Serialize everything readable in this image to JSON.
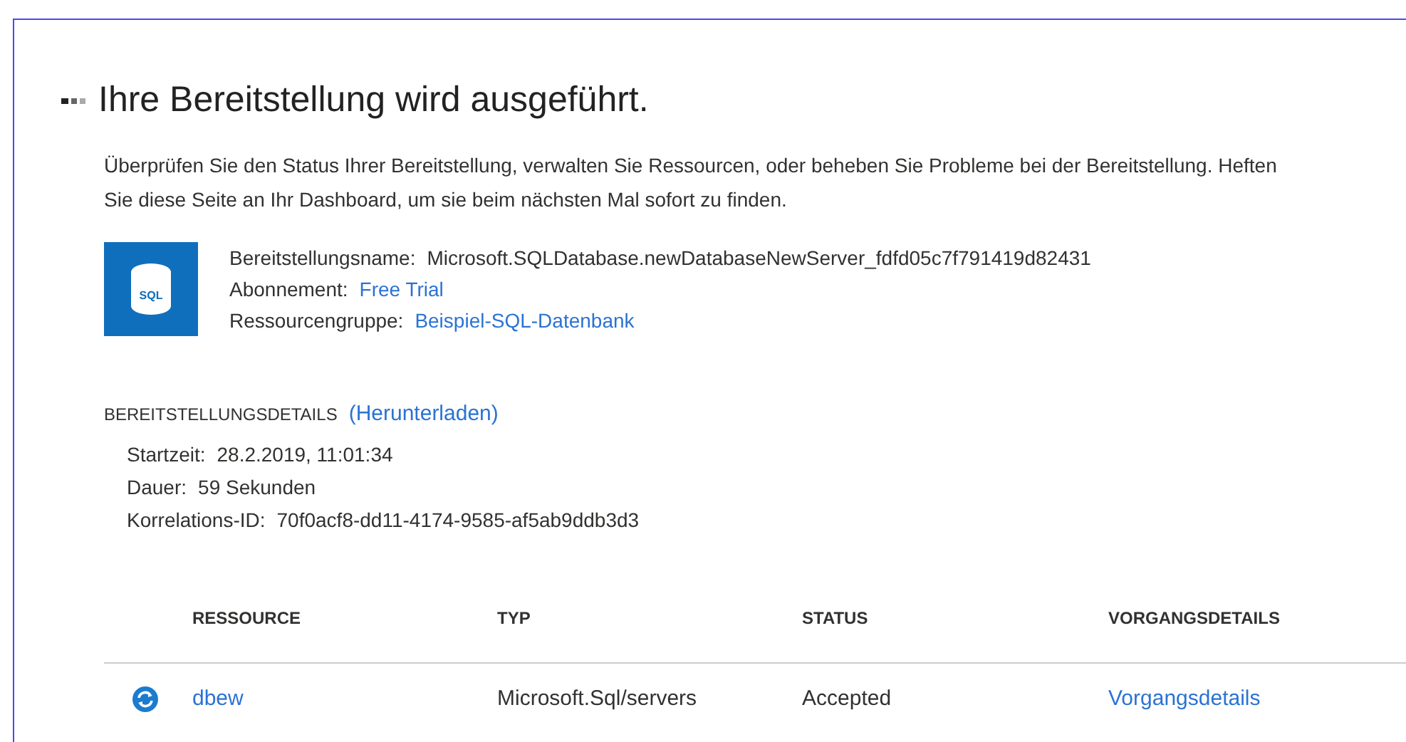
{
  "heading": {
    "title": "Ihre Bereitstellung wird ausgeführt."
  },
  "description": "Überprüfen Sie den Status Ihrer Bereitstellung, verwalten Sie Ressourcen, oder beheben Sie Probleme bei der Bereitstellung. Heften Sie diese Seite an Ihr Dashboard, um sie beim nächsten Mal sofort zu finden.",
  "summary": {
    "icon_label": "SQL",
    "fields": [
      {
        "label": "Bereitstellungsname:",
        "value": "Microsoft.SQLDatabase.newDatabaseNewServer_fdfd05c7f791419d82431",
        "link": false
      },
      {
        "label": "Abonnement:",
        "value": "Free Trial",
        "link": true
      },
      {
        "label": "Ressourcengruppe:",
        "value": "Beispiel-SQL-Datenbank",
        "link": true
      }
    ]
  },
  "details": {
    "title": "BEREITSTELLUNGSDETAILS",
    "download": "(Herunterladen)",
    "fields": [
      {
        "label": "Startzeit:",
        "value": "28.2.2019, 11:01:34"
      },
      {
        "label": "Dauer:",
        "value": "59 Sekunden"
      },
      {
        "label": "Korrelations-ID:",
        "value": "70f0acf8-dd11-4174-9585-af5ab9ddb3d3"
      }
    ]
  },
  "table": {
    "columns": [
      "RESSOURCE",
      "TYP",
      "STATUS",
      "VORGANGSDETAILS"
    ],
    "rows": [
      {
        "resource": "dbew",
        "type": "Microsoft.Sql/servers",
        "status": "Accepted",
        "details": "Vorgangsdetails"
      }
    ]
  }
}
